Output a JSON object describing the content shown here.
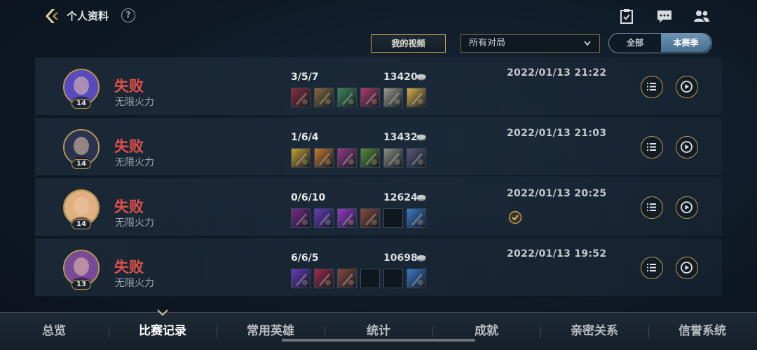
{
  "header": {
    "title": "个人资料",
    "help": "?",
    "icons": [
      "task-icon",
      "chat-icon",
      "friends-icon"
    ]
  },
  "filters": {
    "my_video": "我的视频",
    "match_type": "所有对局",
    "segment": {
      "all": "全部",
      "season": "本赛季",
      "selected": "本赛季"
    }
  },
  "matches": [
    {
      "result": "失败",
      "mode": "无限火力",
      "level": "14",
      "kda": "3/5/7",
      "gold": "13420",
      "datetime": "2022/01/13 21:22",
      "items": [
        "#8a2e3c",
        "#8c6a3a",
        "#3e8a5a",
        "#b23a6a",
        "#9c9c8c",
        "#d8b04a"
      ],
      "champion_color": "#5a4ac0"
    },
    {
      "result": "失败",
      "mode": "无限火力",
      "level": "14",
      "kda": "1/6/4",
      "gold": "13432",
      "datetime": "2022/01/13 21:03",
      "items": [
        "#c8a030",
        "#c87a30",
        "#9a3a8a",
        "#5a8a3a",
        "#8e8e80",
        "#5a5a7a"
      ],
      "champion_color": "#2a3450"
    },
    {
      "result": "失败",
      "mode": "无限火力",
      "level": "14",
      "kda": "0/6/10",
      "gold": "12624",
      "datetime": "2022/01/13 20:25",
      "items": [
        "#7a2a8a",
        "#6a3ac0",
        "#9a3ad0",
        "#8a4a3a",
        "",
        "#3a7ac8"
      ],
      "champion_color": "#e0b080"
    },
    {
      "result": "失败",
      "mode": "无限火力",
      "level": "13",
      "kda": "6/6/5",
      "gold": "10698",
      "datetime": "2022/01/13 19:52",
      "items": [
        "#6a3ac0",
        "#a02a4a",
        "#8a4a3a",
        "",
        "",
        "#3a7ac8"
      ],
      "champion_color": "#7a4a9a"
    }
  ],
  "tabs": [
    {
      "label": "总览",
      "active": false
    },
    {
      "label": "比赛记录",
      "active": true
    },
    {
      "label": "常用英雄",
      "active": false
    },
    {
      "label": "统计",
      "active": false
    },
    {
      "label": "成就",
      "active": false
    },
    {
      "label": "亲密关系",
      "active": false
    },
    {
      "label": "信誉系统",
      "active": false
    }
  ],
  "colors": {
    "accent_gold": "#c8a75c",
    "defeat": "#e0504a",
    "season_active": "#5a82a3"
  }
}
